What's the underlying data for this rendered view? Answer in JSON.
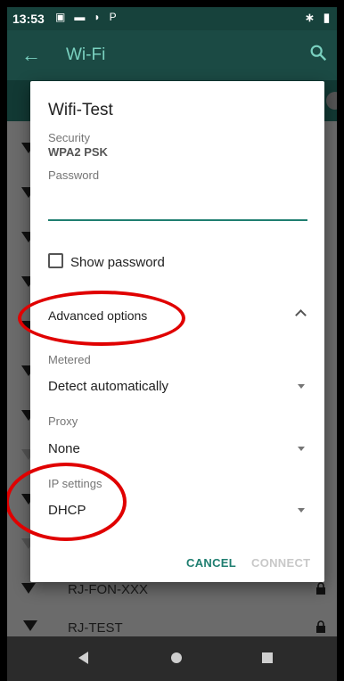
{
  "status_bar": {
    "time": "13:53",
    "icons": [
      "image-icon",
      "voicemail-icon",
      "cast-icon",
      "p-icon"
    ],
    "right_icons": [
      "bluetooth-icon",
      "battery-icon"
    ]
  },
  "app_bar": {
    "title": "Wi-Fi"
  },
  "background_list": [
    {
      "ssid": "RJ-FON-XXX"
    },
    {
      "ssid": "RJ-TEST"
    }
  ],
  "dialog": {
    "title": "Wifi-Test",
    "security_label": "Security",
    "security_value": "WPA2 PSK",
    "password_label": "Password",
    "password_value": "",
    "show_password_label": "Show password",
    "show_password_checked": false,
    "advanced_options_label": "Advanced options",
    "metered_label": "Metered",
    "metered_value": "Detect automatically",
    "proxy_label": "Proxy",
    "proxy_value": "None",
    "ip_settings_label": "IP settings",
    "ip_settings_value": "DHCP",
    "cancel_label": "CANCEL",
    "connect_label": "CONNECT"
  },
  "colors": {
    "accent": "#1f7e70",
    "annotation": "#e00000",
    "app_bar": "#1b4a44",
    "title_text": "#7ad1c0"
  }
}
